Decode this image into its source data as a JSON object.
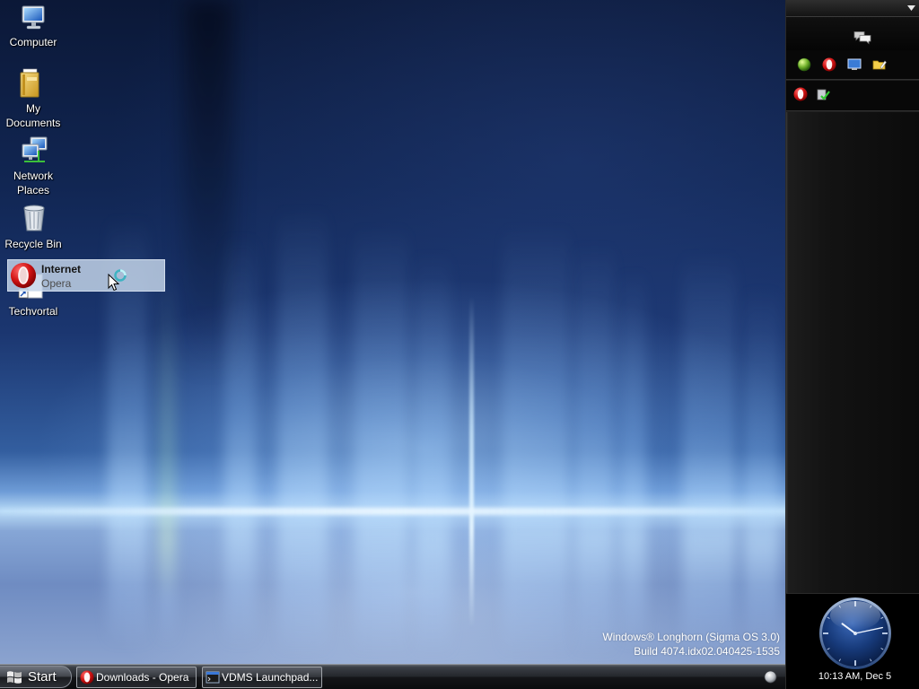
{
  "desktop": {
    "icons": [
      {
        "icon": "computer-icon",
        "label_lines": [
          "Computer"
        ]
      },
      {
        "icon": "my-documents-icon",
        "label_lines": [
          "My",
          "Documents"
        ]
      },
      {
        "icon": "network-places-icon",
        "label_lines": [
          "Network",
          "Places"
        ]
      },
      {
        "icon": "recycle-bin-icon",
        "label_lines": [
          "Recycle Bin"
        ]
      },
      {
        "icon": "shortcut-icon",
        "label_lines": [
          "Techvortal"
        ]
      }
    ],
    "drag_preview": {
      "icon": "opera-icon",
      "title": "Internet",
      "subtitle": "Opera"
    },
    "build_info": {
      "line1": "Windows® Longhorn (Sigma OS 3.0)",
      "line2": "Build 4074.idx02.040425-1535"
    }
  },
  "taskbar": {
    "start_icon": "windows-flag-icon",
    "start_label": "Start",
    "tasks": [
      {
        "icon": "opera-icon",
        "label": "Downloads - Opera"
      },
      {
        "icon": "console-window-icon",
        "label": "VDMS Launchpad..."
      }
    ],
    "tray_icon": "orb-icon"
  },
  "sidebar": {
    "header_icon": "chevron-down-icon",
    "tile_icon": "chat-bubbles-icon",
    "quick_launch": [
      "green-globe-icon",
      "opera-icon",
      "show-desktop-icon",
      "folder-edit-icon"
    ],
    "tray": [
      "opera-icon",
      "security-check-icon"
    ],
    "clock": {
      "hour": 10,
      "minute": 13,
      "caption": "10:13 AM, Dec 5"
    }
  },
  "colors": {
    "desktop_top": "#0b1837",
    "horizon_glow": "#b9dbf7",
    "taskbar": "#24272c",
    "sidebar": "#0b0b0b",
    "clock_face": "#173a7a",
    "opera_red": "#d11414",
    "label_text": "#ffffff"
  }
}
